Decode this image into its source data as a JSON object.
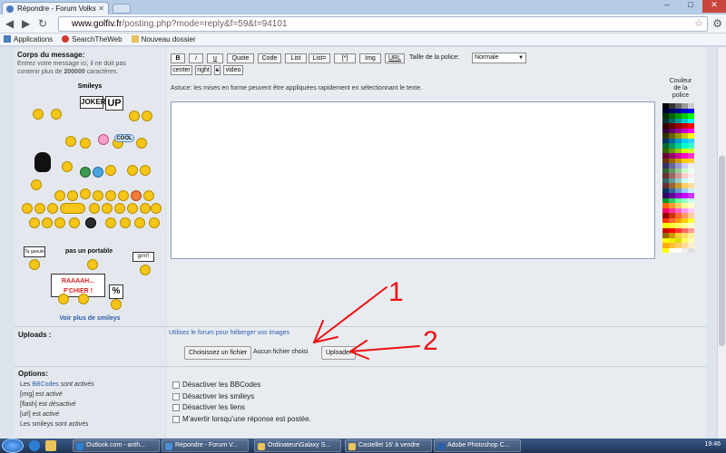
{
  "browser": {
    "tab_title": "Répondre - Forum Volksw",
    "url_domain": "www.golfiv.fr",
    "url_path": "/posting.php?mode=reply&f=59&t=94101",
    "bookmarks": [
      "Applications",
      "SearchTheWeb",
      "Nouveau dossier"
    ]
  },
  "left_panel": {
    "heading": "Corps du message:",
    "desc_1": "Entrez votre message ici, il ne doit pas",
    "desc_2_pre": "contenir plus de ",
    "desc_2_bold": "200000",
    "desc_2_post": " caractères.",
    "smileys_title": "Smileys",
    "sign_joker": "JOKER",
    "sign_up": "UP",
    "sign_cool": "COOL",
    "sign_tg": "Ta gueule",
    "sign_portable": "pas un portable",
    "sign_grr": "grrrr!",
    "sign_raaah_1": "RAAAAH...",
    "sign_raaah_2": "F'CHIER !",
    "sign_pct": "%",
    "more_smileys": "Voir plus de smileys"
  },
  "toolbar": {
    "row1": [
      "B",
      "i",
      "u",
      "Quote",
      "Code",
      "List",
      "List=",
      "[*]",
      "Img",
      "URL"
    ],
    "font_size_label": "Taille de la police:",
    "font_size_value": "Normale",
    "row2": [
      "center",
      "right",
      "s",
      "video"
    ],
    "hint": "Astuce: les mises en forme peuvent être appliquées rapidement en sélectionnant le texte."
  },
  "palette": {
    "title_1": "Couleur",
    "title_2": "de la",
    "title_3": "police"
  },
  "uploads": {
    "label": "Uploads :",
    "hint": "Utilisez le forum pour héberger vos images",
    "choose_label": "Choisissez un fichier",
    "no_file": "Aucun fichier choisi",
    "upload_label": "Uploader"
  },
  "annotations": {
    "one": "1",
    "two": "2"
  },
  "options": {
    "label": "Options:",
    "lines": [
      {
        "pre": "Les ",
        "link": "BBCodes",
        "post": " sont activés"
      },
      {
        "pre": "[img] est ",
        "link": "",
        "post": "activé"
      },
      {
        "pre": "[flash] est ",
        "link": "",
        "post": "désactivé"
      },
      {
        "pre": "[url] est ",
        "link": "",
        "post": "activé"
      },
      {
        "pre": "Les smileys sont ",
        "link": "",
        "post": "activés"
      }
    ],
    "checkboxes": [
      "Désactiver les BBCodes",
      "Désactiver les smileys",
      "Désactiver les liens",
      "M'avertir lorsqu'une réponse est postée."
    ]
  },
  "taskbar": {
    "items": [
      "Outlook.com - anth...",
      "Répondre - Forum V...",
      "Ordinateur\\Galaxy S...",
      "Castellet 16' à vendre",
      "Adobe Photoshop C..."
    ],
    "clock": "19:46"
  }
}
